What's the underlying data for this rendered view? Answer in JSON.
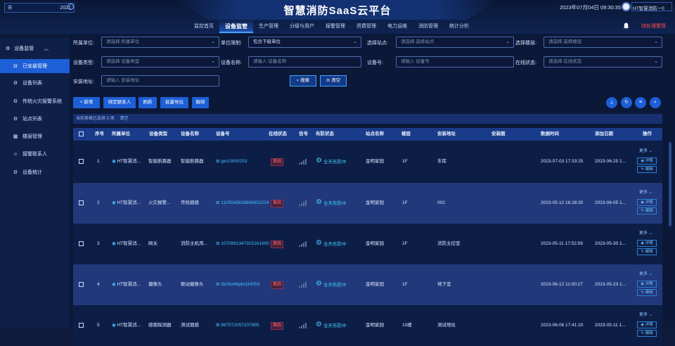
{
  "topbar": {
    "left_year": "2021",
    "title": "智慧消防SaaS云平台",
    "datetime": "2023年07月04日 09:30:35",
    "user": "HT智慧消防一0",
    "pending": "待处理警情"
  },
  "nav": [
    "监控首页",
    "设备监管",
    "生产管理",
    "分级与用户",
    "报警管理",
    "资费管理",
    "电力运维",
    "消防管理",
    "统计分析"
  ],
  "nav_active": 1,
  "sidebar": {
    "header": "设备监管",
    "items": [
      "已安装管理",
      "设备列表",
      "传统火灾报警系统",
      "站点列表",
      "楼层管理",
      "接警联系人",
      "设备统计"
    ]
  },
  "filters": {
    "unit_label": "所属单位:",
    "unit_ph": "请选择 所属单位",
    "limit_label": "单位限制:",
    "limit_value": "包含下级单位",
    "site_label": "选择站点:",
    "site_ph": "请选择 选择站点",
    "floor_label": "选择楼层:",
    "floor_ph": "请选择 选择楼层",
    "type_label": "设备类型:",
    "type_ph": "请选择 设备类型",
    "name_label": "设备名称:",
    "name_ph": "请输入 设备名称",
    "no_label": "设备号:",
    "no_ph": "请输入 设备号",
    "status_label": "在线状态:",
    "status_ph": "请选择 在线状态",
    "addr_label": "安装地址:",
    "addr_ph": "请输入 安装地址",
    "search": "搜索",
    "clear": "清空"
  },
  "actions": [
    "新增",
    "绑定联系人",
    "刷新",
    "批量导出",
    "解绑"
  ],
  "selection": {
    "text": "当前表格已选择 0 项",
    "clear": "清空"
  },
  "columns": [
    "序号",
    "所属单位",
    "设备类型",
    "设备名称",
    "设备号",
    "在线状态",
    "信号",
    "布防状态",
    "站点名称",
    "楼层",
    "安装地址",
    "安装图",
    "数据时间",
    "添加日期",
    "操作"
  ],
  "rows": [
    {
      "no": "1",
      "unit": "HT智慧消...",
      "type": "智能断路器",
      "name": "智能断路器",
      "dev": "gw10000253",
      "status": "离线",
      "armed": "全天布防中",
      "site": "金明家园",
      "floor": "1F",
      "addr": "车库",
      "time": "2023-07-03 17:33:25",
      "added": "2023-06-25 1..."
    },
    {
      "no": "2",
      "unit": "HT智慧消...",
      "type": "火灾报警...",
      "name": "传统烟感",
      "dev": "1105545638889652224",
      "status": "离线",
      "armed": "全天布防中",
      "site": "金明家园",
      "floor": "1F",
      "addr": "002",
      "time": "2023-05-12 16:28:30",
      "added": "2023-06-05 1..."
    },
    {
      "no": "3",
      "unit": "HT智慧消...",
      "type": "网关",
      "name": "消防主机用...",
      "dev": "1070991347915161600",
      "status": "离线",
      "armed": "全天布防中",
      "site": "金明家园",
      "floor": "1F",
      "addr": "消防主控室",
      "time": "2023-05-11 17:52:59",
      "added": "2023-05-30 1..."
    },
    {
      "no": "4",
      "unit": "HT智慧消...",
      "type": "摄像头",
      "name": "联动摄像头",
      "dev": "5k08d48pbcl34059",
      "status": "离线",
      "armed": "全天布防中",
      "site": "金明家园",
      "floor": "1F",
      "addr": "地下室",
      "time": "2023-06-12 11:00:27",
      "added": "2023-05-23 1..."
    },
    {
      "no": "5",
      "unit": "HT智慧消...",
      "type": "感烟探测器",
      "name": "测试烟感",
      "dev": "867572057207995",
      "status": "离线",
      "armed": "全天布防中",
      "site": "金明家园",
      "floor": "10楼",
      "addr": "测试地址",
      "time": "2023-06-06 17:41:10",
      "added": "2023-05-11 1..."
    }
  ],
  "row_ops": {
    "more": "更多",
    "detail": "详情",
    "edit": "编辑"
  }
}
